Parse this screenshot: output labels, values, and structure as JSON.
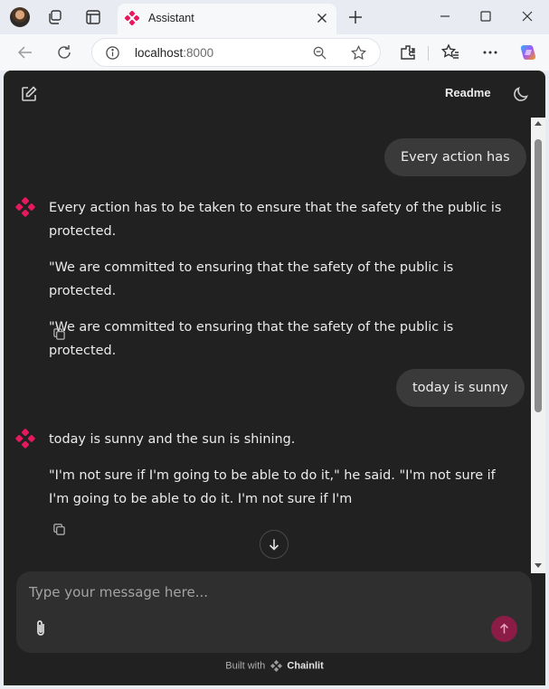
{
  "browser": {
    "tab_title": "Assistant",
    "url_host": "localhost",
    "url_port": ":8000"
  },
  "header": {
    "readme_label": "Readme"
  },
  "messages": [
    {
      "role": "user",
      "text": "Every action has"
    },
    {
      "role": "assistant",
      "paragraphs": [
        "Every action has to be taken to ensure that the safety of the public is protected.",
        "\"We are committed to ensuring that the safety of the public is protected.",
        "\"We are committed to ensuring that the safety of the public is protected."
      ]
    },
    {
      "role": "user",
      "text": "today is sunny"
    },
    {
      "role": "assistant",
      "paragraphs": [
        "today is sunny and the sun is shining.",
        "\"I'm not sure if I'm going to be able to do it,\" he said. \"I'm not sure if I'm going to be able to do it. I'm not sure if I'm"
      ]
    }
  ],
  "composer": {
    "placeholder": "Type your message here..."
  },
  "footer": {
    "built_with": "Built with",
    "brand": "Chainlit"
  },
  "colors": {
    "app_bg": "#212121",
    "bubble_bg": "#3a3a3a",
    "accent": "#e8185e",
    "send_bg": "#8b1c45"
  },
  "icons": [
    "profile-avatar",
    "workspaces-icon",
    "tab-actions-icon",
    "assistant-favicon",
    "close-icon",
    "plus-icon",
    "minimize-icon",
    "maximize-icon",
    "back-icon",
    "reload-icon",
    "info-icon",
    "zoom-icon",
    "star-icon",
    "extensions-icon",
    "favorites-icon",
    "more-icon",
    "copilot-icon",
    "edit-icon",
    "moon-icon",
    "copy-icon",
    "arrow-down-icon",
    "paperclip-icon",
    "arrow-up-icon",
    "chainlit-logo"
  ]
}
